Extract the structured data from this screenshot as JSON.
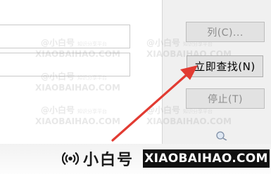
{
  "buttons": {
    "columns": "列(C)...",
    "search_now": "立即查找(N)",
    "stop": "停止(T)"
  },
  "watermark": {
    "brand_cn": "小白号",
    "brand_url": "XIAOBAIHAO.COM",
    "tile_handle": "@小白号",
    "tile_tagline": "知识分享平台",
    "tile_url": "XIAOBAIHAO.COM"
  },
  "colors": {
    "arrow": "#e23b32",
    "window_bg": "#f0f0f0",
    "disabled_text": "#8c8c8c"
  }
}
